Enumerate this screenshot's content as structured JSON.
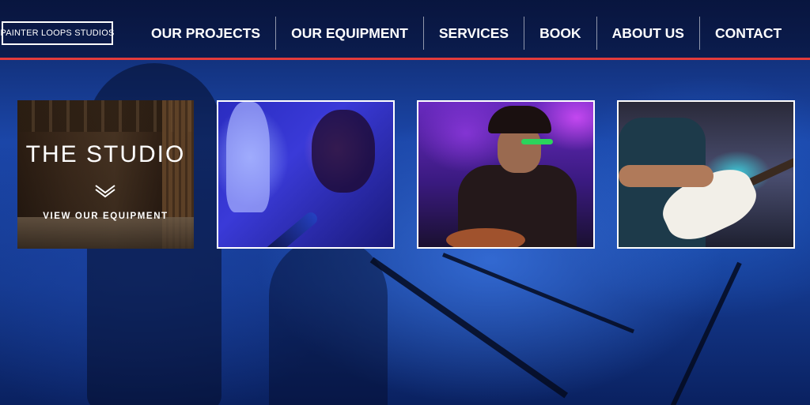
{
  "header": {
    "logo_text": "PAINTER LOOPS STUDIOS",
    "nav": [
      {
        "label": "OUR PROJECTS"
      },
      {
        "label": "OUR EQUIPMENT"
      },
      {
        "label": "SERVICES"
      },
      {
        "label": "BOOK"
      },
      {
        "label": "ABOUT US"
      },
      {
        "label": "CONTACT"
      }
    ],
    "accent_color": "#e23b3b"
  },
  "tiles": {
    "studio": {
      "title": "THE STUDIO",
      "link_label": "VIEW OUR EQUIPMENT",
      "icon": "double-chevron-down-icon"
    },
    "photos": [
      {
        "subject": "singer-with-microphone"
      },
      {
        "subject": "guitarist-singer-with-hat"
      },
      {
        "subject": "bass-player"
      }
    ]
  },
  "background": {
    "subject": "concert-stage-blue-lighting"
  }
}
